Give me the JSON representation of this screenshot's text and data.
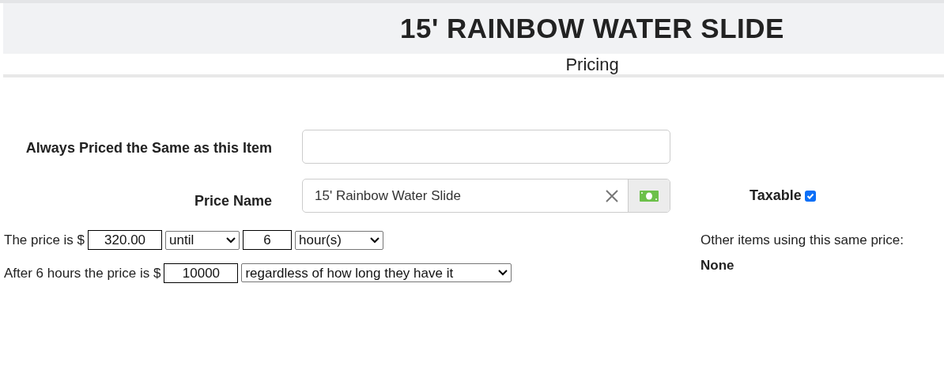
{
  "header": {
    "title": "15' RAINBOW WATER SLIDE",
    "subtitle": "Pricing"
  },
  "same_as_item": {
    "label": "Always Priced the Same as this Item"
  },
  "price_name": {
    "label": "Price Name",
    "value": "15' Rainbow Water Slide"
  },
  "taxable": {
    "label": "Taxable",
    "checked": true
  },
  "price_rule": {
    "prefix": "The price is $",
    "amount": "320.00",
    "mode": "until",
    "duration": "6",
    "unit": "hour(s)"
  },
  "after_rule": {
    "prefix": "After 6 hours the price is $",
    "amount": "10000",
    "mode": "regardless of how long they have it"
  },
  "other_items": {
    "label": "Other items using this same price:",
    "value": "None"
  }
}
